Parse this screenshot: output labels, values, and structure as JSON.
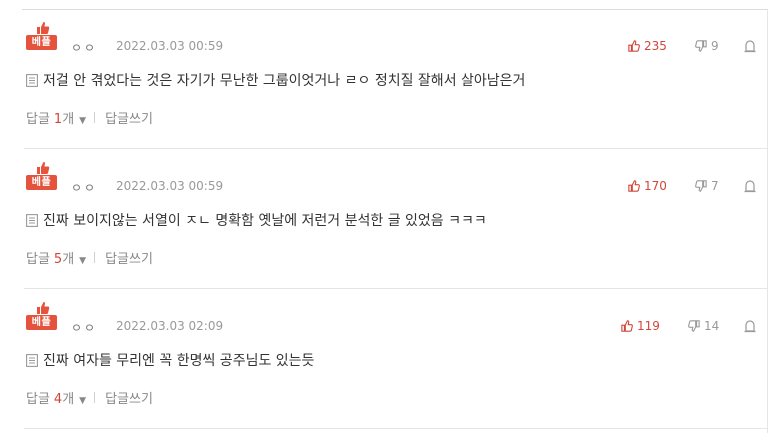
{
  "badge_label": "베플",
  "reply_label": "답글",
  "reply_unit": "개",
  "write_reply_label": "답글쓰기",
  "colors": {
    "accent": "#e5533d",
    "like": "#d0473a",
    "muted": "#999999"
  },
  "comments": [
    {
      "author": "ㅇㅇ",
      "date": "2022.03.03 00:59",
      "likes": "235",
      "dislikes": "9",
      "text": "저걸 안 겪었다는 것은 자기가 무난한 그룹이엇거나 ㄹㅇ 정치질 잘해서 살아남은거",
      "reply_count": "1"
    },
    {
      "author": "ㅇㅇ",
      "date": "2022.03.03 00:59",
      "likes": "170",
      "dislikes": "7",
      "text": "진짜 보이지않는 서열이 ㅈㄴ 명확함 옛날에 저런거 분석한 글 있었음 ㅋㅋㅋ",
      "reply_count": "5"
    },
    {
      "author": "ㅇㅇ",
      "date": "2022.03.03 02:09",
      "likes": "119",
      "dislikes": "14",
      "text": "진짜 여자들 무리엔 꼭 한명씩 공주님도 있는듯",
      "reply_count": "4"
    }
  ]
}
